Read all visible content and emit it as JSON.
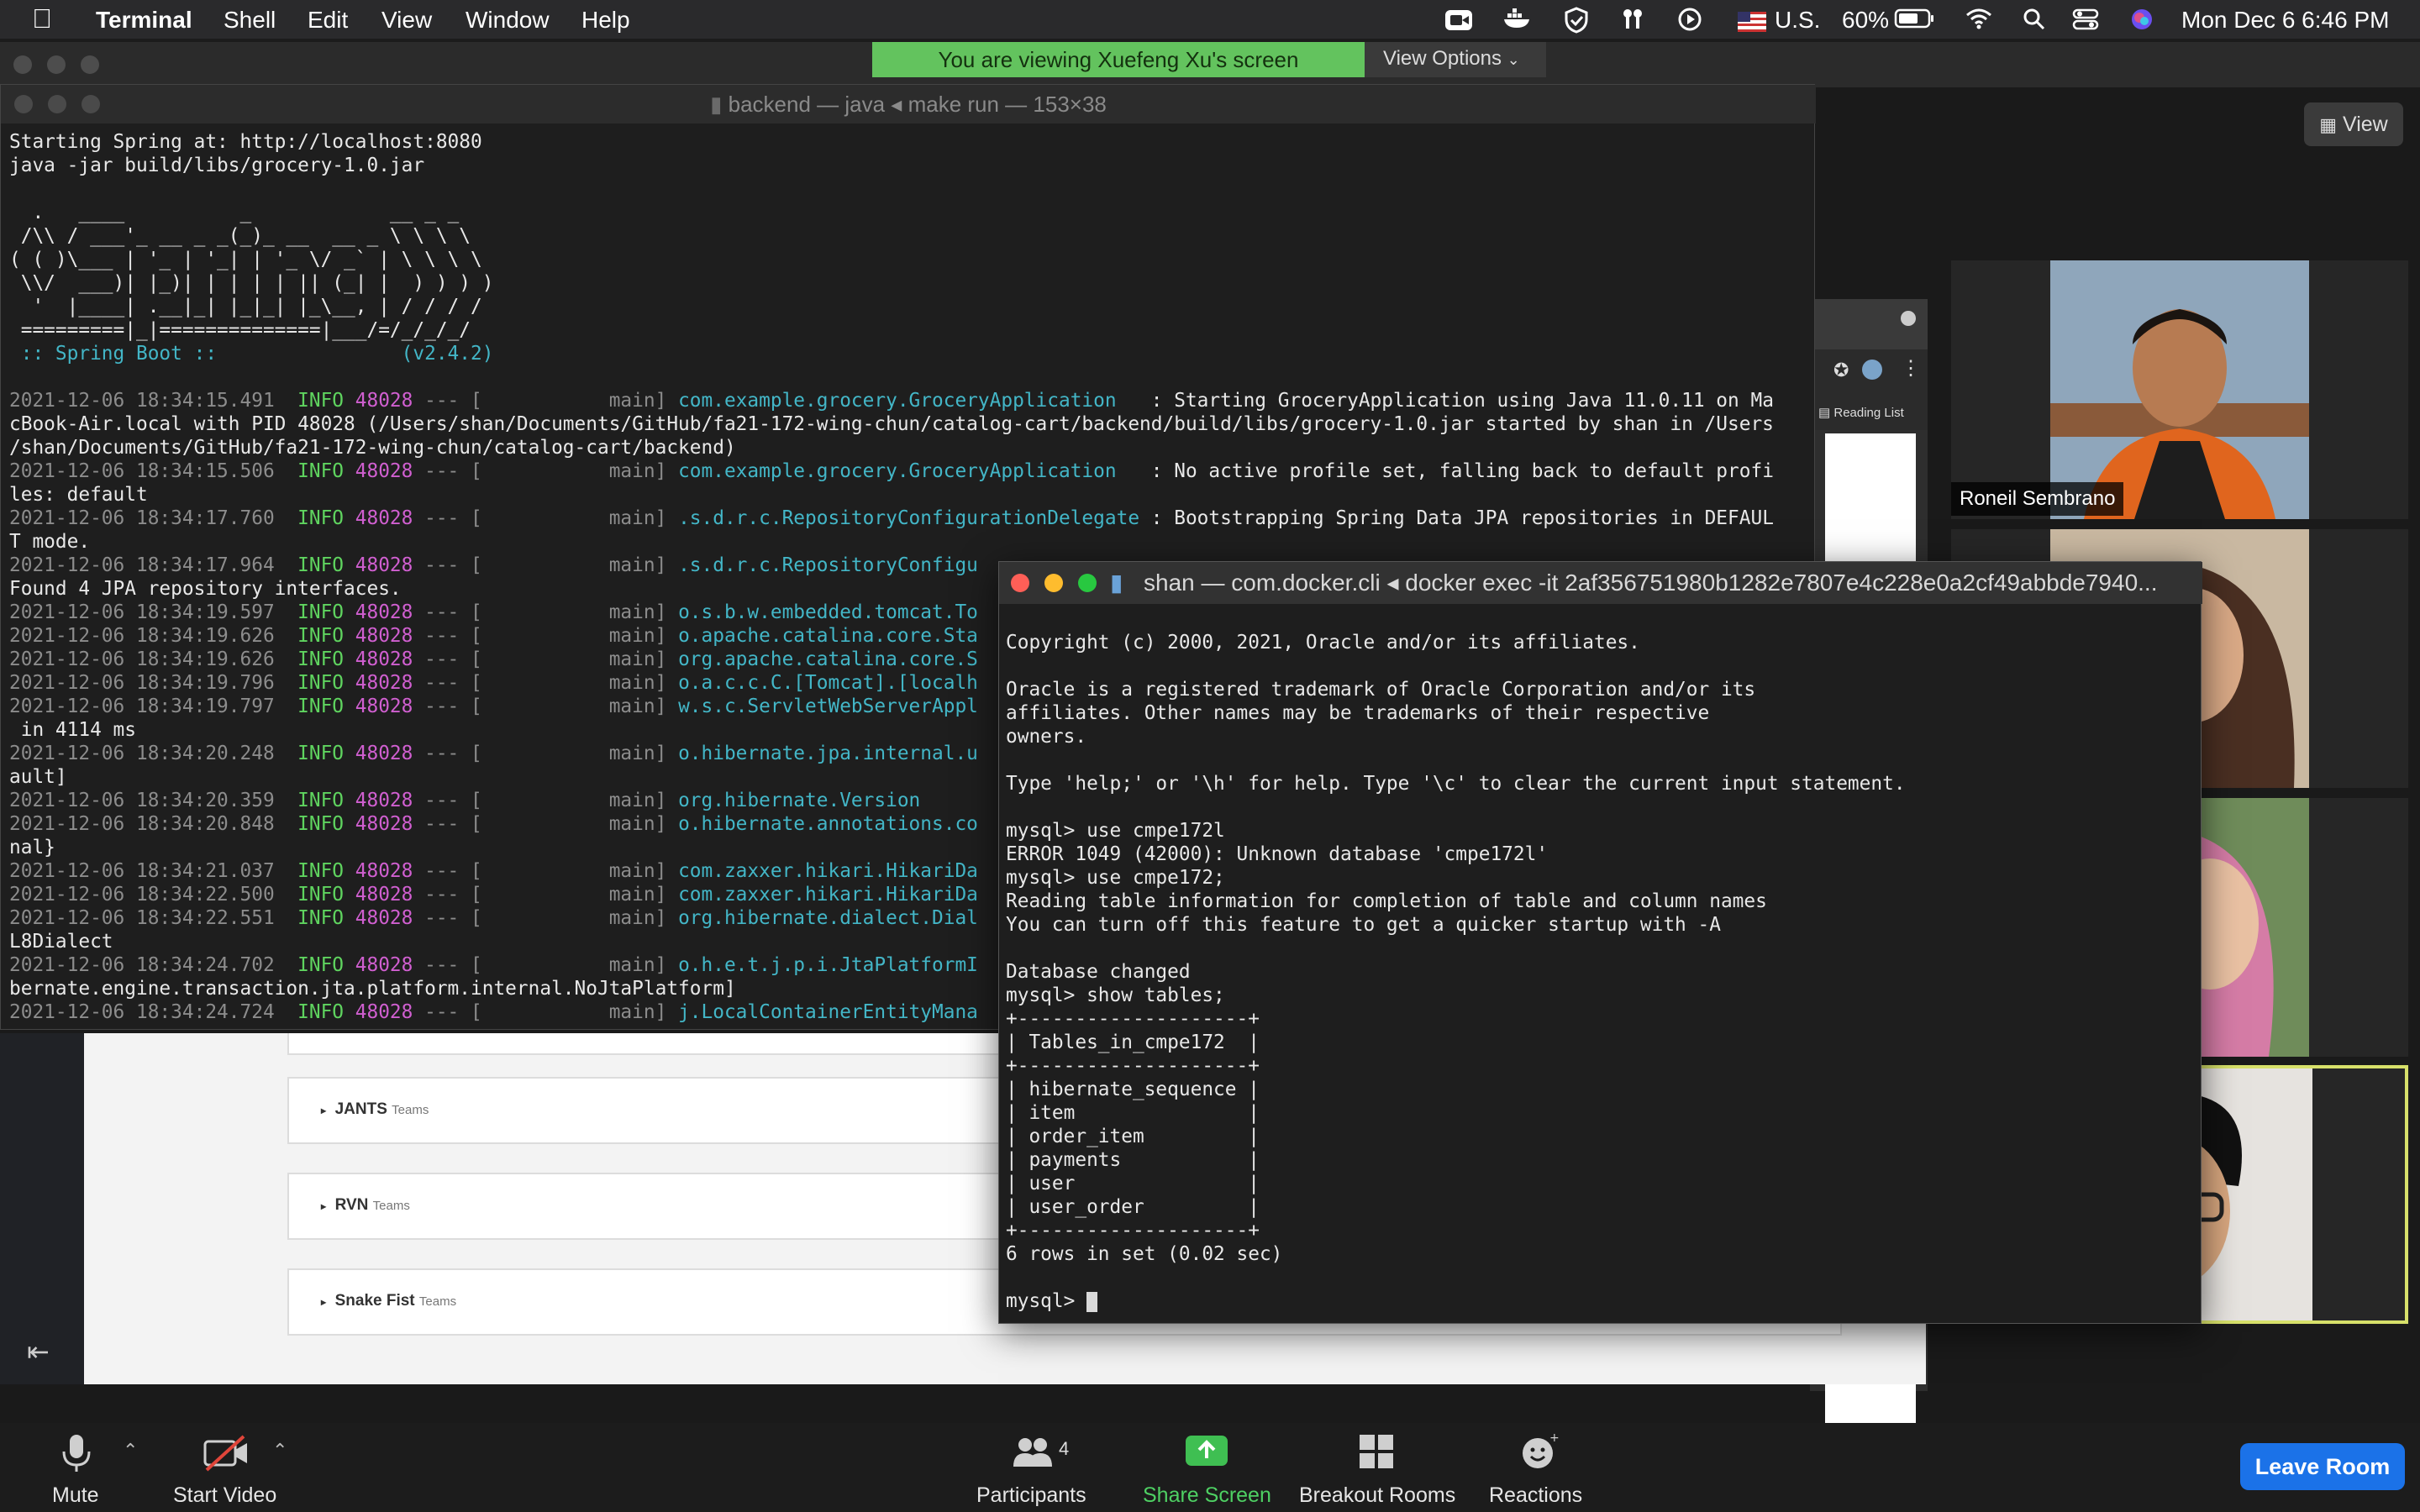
{
  "menubar": {
    "app": "Terminal",
    "items": [
      "Shell",
      "Edit",
      "View",
      "Window",
      "Help"
    ],
    "input_source": "U.S.",
    "battery": "60%",
    "datetime": "Mon Dec 6  6:46 PM"
  },
  "zoom": {
    "banner": "You are viewing Xuefeng Xu's screen",
    "view_options": "View Options",
    "view_button": "View",
    "reading_list": "Reading List",
    "participants": [
      {
        "name": "Roneil Sembrano"
      },
      {
        "name": ""
      },
      {
        "name": ""
      },
      {
        "name": ""
      }
    ],
    "toolbar": {
      "mute": "Mute",
      "start_video": "Start Video",
      "participants": "Participants",
      "participants_count": "4",
      "share_screen": "Share Screen",
      "breakout_rooms": "Breakout Rooms",
      "reactions": "Reactions",
      "leave": "Leave Room"
    }
  },
  "shared_page": {
    "teams": [
      {
        "name": "JANTS",
        "suffix": "Teams"
      },
      {
        "name": "RVN",
        "suffix": "Teams"
      },
      {
        "name": "Snake Fist",
        "suffix": "Teams"
      }
    ]
  },
  "terminal1": {
    "title": "backend — java ◂ make run — 153×38",
    "lines": [
      "Starting Spring at: http://localhost:8080",
      "java -jar build/libs/grocery-1.0.jar",
      "",
      "  .   ____          _            __ _ _",
      " /\\\\ / ___'_ __ _ _(_)_ __  __ _ \\ \\ \\ \\",
      "( ( )\\___ | '_ | '_| | '_ \\/ _` | \\ \\ \\ \\",
      " \\\\/  ___)| |_)| | | | | || (_| |  ) ) ) )",
      "  '  |____| .__|_| |_|_| |_\\__, | / / / /",
      " =========|_|==============|___/=/_/_/_/",
      " :: Spring Boot ::                (v2.4.2)",
      ""
    ],
    "logs": [
      {
        "ts": "2021-12-06 18:34:15.491",
        "level": "INFO",
        "pid": "48028",
        "thread": "main",
        "logger": "com.example.grocery.GroceryApplication  ",
        "msg": " : Starting GroceryApplication using Java 11.0.11 on Ma",
        "cont": [
          "cBook-Air.local with PID 48028 (/Users/shan/Documents/GitHub/fa21-172-wing-chun/catalog-cart/backend/build/libs/grocery-1.0.jar started by shan in /Users",
          "/shan/Documents/GitHub/fa21-172-wing-chun/catalog-cart/backend)"
        ]
      },
      {
        "ts": "2021-12-06 18:34:15.506",
        "level": "INFO",
        "pid": "48028",
        "thread": "main",
        "logger": "com.example.grocery.GroceryApplication  ",
        "msg": " : No active profile set, falling back to default profi",
        "cont": [
          "les: default"
        ]
      },
      {
        "ts": "2021-12-06 18:34:17.760",
        "level": "INFO",
        "pid": "48028",
        "thread": "main",
        "logger": ".s.d.r.c.RepositoryConfigurationDelegate",
        "msg": " : Bootstrapping Spring Data JPA repositories in DEFAUL",
        "cont": [
          "T mode."
        ]
      },
      {
        "ts": "2021-12-06 18:34:17.964",
        "level": "INFO",
        "pid": "48028",
        "thread": "main",
        "logger": ".s.d.r.c.RepositoryConfigu",
        "msg": "",
        "cont": [
          "Found 4 JPA repository interfaces."
        ]
      },
      {
        "ts": "2021-12-06 18:34:19.597",
        "level": "INFO",
        "pid": "48028",
        "thread": "main",
        "logger": "o.s.b.w.embedded.tomcat.To",
        "msg": "",
        "cont": []
      },
      {
        "ts": "2021-12-06 18:34:19.626",
        "level": "INFO",
        "pid": "48028",
        "thread": "main",
        "logger": "o.apache.catalina.core.Sta",
        "msg": "",
        "cont": []
      },
      {
        "ts": "2021-12-06 18:34:19.626",
        "level": "INFO",
        "pid": "48028",
        "thread": "main",
        "logger": "org.apache.catalina.core.S",
        "msg": "",
        "cont": []
      },
      {
        "ts": "2021-12-06 18:34:19.796",
        "level": "INFO",
        "pid": "48028",
        "thread": "main",
        "logger": "o.a.c.c.C.[Tomcat].[localh",
        "msg": "",
        "cont": []
      },
      {
        "ts": "2021-12-06 18:34:19.797",
        "level": "INFO",
        "pid": "48028",
        "thread": "main",
        "logger": "w.s.c.ServletWebServerAppl",
        "msg": "",
        "cont": [
          " in 4114 ms"
        ]
      },
      {
        "ts": "2021-12-06 18:34:20.248",
        "level": "INFO",
        "pid": "48028",
        "thread": "main",
        "logger": "o.hibernate.jpa.internal.u",
        "msg": "",
        "cont": [
          "ault]"
        ]
      },
      {
        "ts": "2021-12-06 18:34:20.359",
        "level": "INFO",
        "pid": "48028",
        "thread": "main",
        "logger": "org.hibernate.Version",
        "msg": "",
        "cont": []
      },
      {
        "ts": "2021-12-06 18:34:20.848",
        "level": "INFO",
        "pid": "48028",
        "thread": "main",
        "logger": "o.hibernate.annotations.co",
        "msg": "",
        "cont": [
          "nal}"
        ]
      },
      {
        "ts": "2021-12-06 18:34:21.037",
        "level": "INFO",
        "pid": "48028",
        "thread": "main",
        "logger": "com.zaxxer.hikari.HikariDa",
        "msg": "",
        "cont": []
      },
      {
        "ts": "2021-12-06 18:34:22.500",
        "level": "INFO",
        "pid": "48028",
        "thread": "main",
        "logger": "com.zaxxer.hikari.HikariDa",
        "msg": "",
        "cont": []
      },
      {
        "ts": "2021-12-06 18:34:22.551",
        "level": "INFO",
        "pid": "48028",
        "thread": "main",
        "logger": "org.hibernate.dialect.Dial",
        "msg": "",
        "cont": [
          "L8Dialect"
        ]
      },
      {
        "ts": "2021-12-06 18:34:24.702",
        "level": "INFO",
        "pid": "48028",
        "thread": "main",
        "logger": "o.h.e.t.j.p.i.JtaPlatformI",
        "msg": "",
        "cont": [
          "bernate.engine.transaction.jta.platform.internal.NoJtaPlatform]"
        ]
      },
      {
        "ts": "2021-12-06 18:34:24.724",
        "level": "INFO",
        "pid": "48028",
        "thread": "main",
        "logger": "j.LocalContainerEntityMana",
        "msg": "",
        "cont": []
      }
    ]
  },
  "terminal2": {
    "title": "shan — com.docker.cli ◂ docker exec -it 2af356751980b1282e7807e4c228e0a2cf49abbde7940...",
    "lines": [
      "Copyright (c) 2000, 2021, Oracle and/or its affiliates.",
      "",
      "Oracle is a registered trademark of Oracle Corporation and/or its",
      "affiliates. Other names may be trademarks of their respective",
      "owners.",
      "",
      "Type 'help;' or '\\h' for help. Type '\\c' to clear the current input statement.",
      "",
      "mysql> use cmpe172l",
      "ERROR 1049 (42000): Unknown database 'cmpe172l'",
      "mysql> use cmpe172;",
      "Reading table information for completion of table and column names",
      "You can turn off this feature to get a quicker startup with -A",
      "",
      "Database changed",
      "mysql> show tables;",
      "+--------------------+",
      "| Tables_in_cmpe172  |",
      "+--------------------+",
      "| hibernate_sequence |",
      "| item               |",
      "| order_item         |",
      "| payments           |",
      "| user               |",
      "| user_order         |",
      "+--------------------+",
      "6 rows in set (0.02 sec)",
      ""
    ],
    "prompt": "mysql> "
  },
  "colors": {
    "banner": "#63c35e",
    "leave": "#1b72e8",
    "log_info": "#5fd45f",
    "log_pid": "#d05fd0",
    "logger": "#43b6c7"
  }
}
